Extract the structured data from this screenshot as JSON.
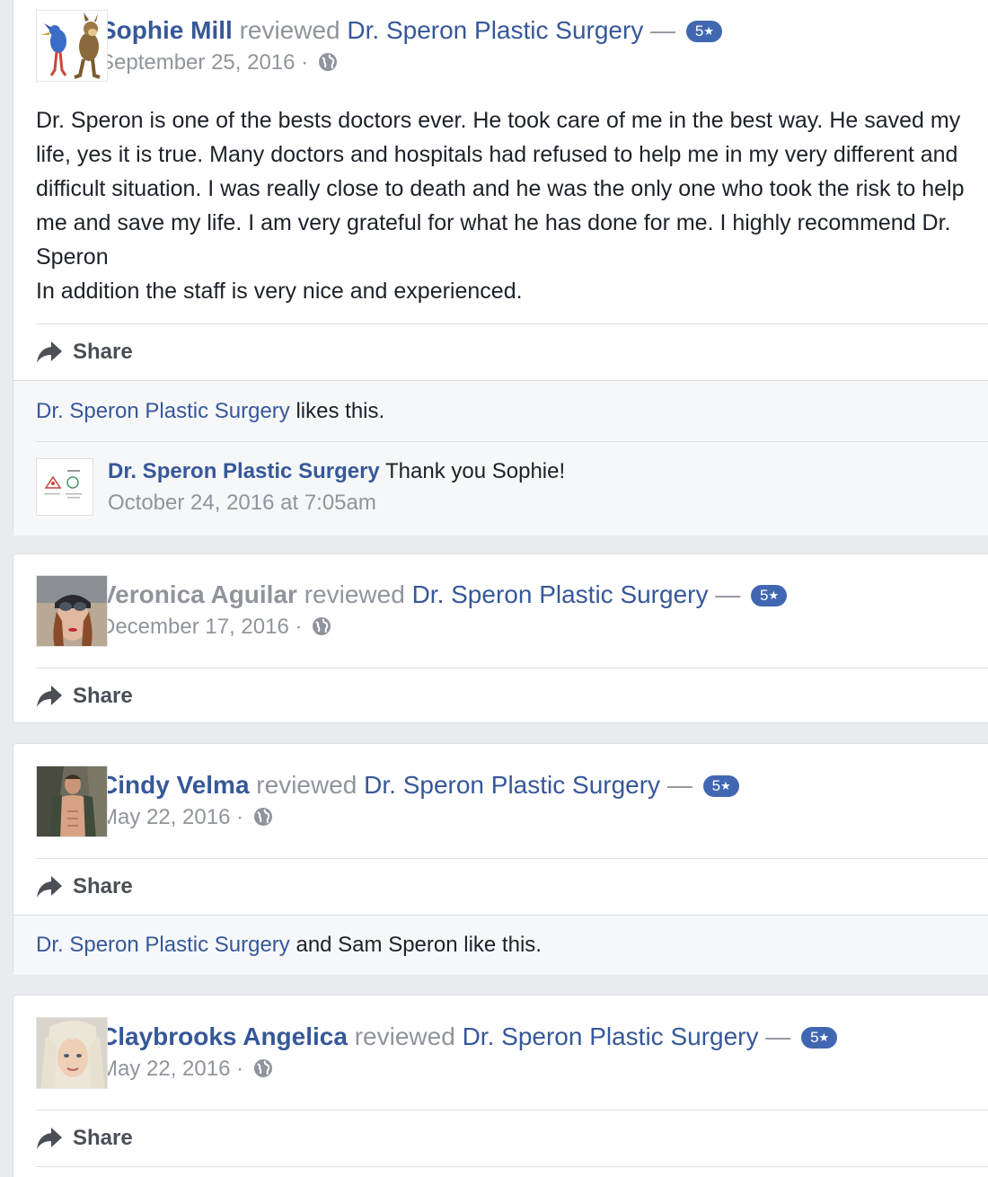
{
  "reviews": [
    {
      "author": "Sophie Mill",
      "verb": "reviewed",
      "page": "Dr. Speron Plastic Surgery",
      "dash": "—",
      "rating": "5",
      "star": "★",
      "date": "September 25, 2016",
      "separator": "·",
      "privacy_icon": "globe-icon",
      "text": "Dr. Speron is one of the bests doctors ever. He took care of me in the best way. He saved my life, yes it is true. Many doctors and hospitals had refused to help me in my very different and difficult situation. I was really close to death and he was the only one who took the risk to help me and save my life. I am very grateful for what he has done for me. I highly recommend Dr. Speron\nIn addition the staff is very nice and experienced.",
      "share_label": "Share",
      "likes": {
        "link": "Dr. Speron Plastic Surgery",
        "rest": " likes this."
      },
      "reply": {
        "author": "Dr. Speron Plastic Surgery",
        "text": " Thank you Sophie!",
        "time": "October 24, 2016 at 7:05am"
      }
    },
    {
      "author": "Veronica Aguilar",
      "verb": "reviewed",
      "page": "Dr. Speron Plastic Surgery",
      "dash": "—",
      "rating": "5",
      "star": "★",
      "date": "December 17, 2016",
      "separator": "·",
      "privacy_icon": "globe-icon",
      "share_label": "Share"
    },
    {
      "author": "Cindy Velma",
      "verb": "reviewed",
      "page": "Dr. Speron Plastic Surgery",
      "dash": "—",
      "rating": "5",
      "star": "★",
      "date": "May 22, 2016",
      "separator": "·",
      "privacy_icon": "globe-icon",
      "share_label": "Share",
      "likes": {
        "link": "Dr. Speron Plastic Surgery",
        "rest": " and Sam Speron like this."
      }
    },
    {
      "author": "Claybrooks Angelica",
      "verb": "reviewed",
      "page": "Dr. Speron Plastic Surgery",
      "dash": "—",
      "rating": "5",
      "star": "★",
      "date": "May 22, 2016",
      "separator": "·",
      "privacy_icon": "globe-icon",
      "share_label": "Share"
    }
  ],
  "colors": {
    "link": "#365899",
    "muted": "#90949c",
    "badge": "#4267b2",
    "background": "#e9ebee"
  }
}
